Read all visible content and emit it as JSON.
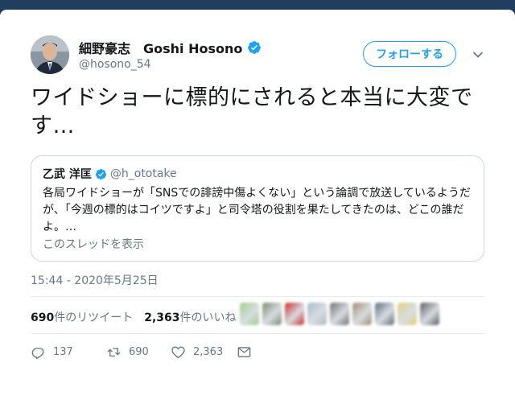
{
  "author": {
    "display_name": "細野豪志　Goshi Hosono",
    "handle": "@hosono_54",
    "verified": true
  },
  "follow_button": {
    "label": "フォローする"
  },
  "tweet": {
    "text": "ワイドショーに標的にされると本当に大変です…"
  },
  "quoted_tweet": {
    "display_name": "乙武 洋匡",
    "handle": "@h_ototake",
    "text": "各局ワイドショーが「SNSでの誹謗中傷よくない」という論調で放送しているようだが、「今週の標的はコイツですよ」と司令塔の役割を果たしてきたのは、どこの誰だよ。…",
    "thread_link": "このスレッドを表示"
  },
  "timestamp": "15:44 - 2020年5月25日",
  "stats": {
    "retweets_count": "690",
    "retweets_label": "件のリツイート",
    "likes_count": "2,363",
    "likes_label": "件のいいね"
  },
  "liker_colors": [
    "#9ecf8a",
    "#7a8a6e",
    "#c92a2a",
    "#a9b8c6",
    "#6e6e6e",
    "#a08a70",
    "#5a6a7a",
    "#e2cf7a",
    "#5a5a5a"
  ],
  "actions": {
    "reply_count": "137",
    "retweet_count": "690",
    "like_count": "2,363"
  },
  "colors": {
    "accent": "#1da1f2",
    "muted": "#657786",
    "border": "#ccd6dd"
  }
}
